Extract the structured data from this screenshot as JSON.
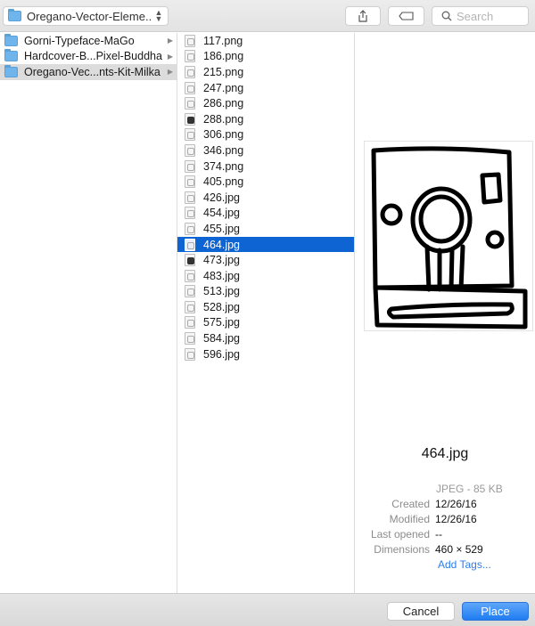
{
  "toolbar": {
    "location": "Oregano-Vector-Eleme...",
    "search_placeholder": "Search"
  },
  "folders": [
    {
      "label": "Gorni-Typeface-MaGo",
      "selected": false
    },
    {
      "label": "Hardcover-B...Pixel-Buddha",
      "selected": false
    },
    {
      "label": "Oregano-Vec...nts-Kit-Milka",
      "selected": true
    }
  ],
  "files": [
    {
      "name": "117.png"
    },
    {
      "name": "186.png"
    },
    {
      "name": "215.png"
    },
    {
      "name": "247.png"
    },
    {
      "name": "286.png"
    },
    {
      "name": "288.png"
    },
    {
      "name": "306.png"
    },
    {
      "name": "346.png"
    },
    {
      "name": "374.png"
    },
    {
      "name": "405.png"
    },
    {
      "name": "426.jpg"
    },
    {
      "name": "454.jpg"
    },
    {
      "name": "455.jpg"
    },
    {
      "name": "464.jpg"
    },
    {
      "name": "473.jpg"
    },
    {
      "name": "483.jpg"
    },
    {
      "name": "513.jpg"
    },
    {
      "name": "528.jpg"
    },
    {
      "name": "575.jpg"
    },
    {
      "name": "584.jpg"
    },
    {
      "name": "596.jpg"
    }
  ],
  "selected_file": "464.jpg",
  "preview": {
    "filename": "464.jpg",
    "kind": "JPEG - 85 KB",
    "created_label": "Created",
    "created": "12/26/16",
    "modified_label": "Modified",
    "modified": "12/26/16",
    "last_opened_label": "Last opened",
    "last_opened": "--",
    "dimensions_label": "Dimensions",
    "dimensions": "460 × 529",
    "add_tags": "Add Tags..."
  },
  "footer": {
    "cancel": "Cancel",
    "place": "Place"
  },
  "colors": {
    "selection": "#0e64d2",
    "accent": "#2b7de9"
  }
}
